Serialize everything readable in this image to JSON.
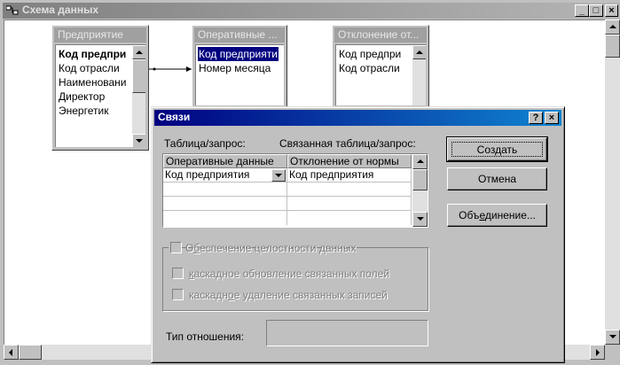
{
  "window": {
    "title": "Схема данных",
    "minimize": "_",
    "maximize": "□",
    "close": "×"
  },
  "tables": [
    {
      "title": "Предприятие",
      "fields": [
        "Код предпри",
        "Код отрасли",
        "Наименовани",
        "Директор",
        "Энергетик"
      ]
    },
    {
      "title": "Оперативные ...",
      "fields": [
        "Код предприяти",
        "Номер месяца"
      ]
    },
    {
      "title": "Отклонение от...",
      "fields": [
        "Код предпри",
        "Код отрасли"
      ]
    }
  ],
  "dialog": {
    "title": "Связи",
    "help": "?",
    "close": "×",
    "label_table": "Таблица/запрос:",
    "label_related": "Связанная таблица/запрос:",
    "grid": {
      "headers": [
        "Оперативные данные",
        "Отклонение от нормы"
      ],
      "rows": [
        [
          "Код предприятия",
          "Код предприятия"
        ]
      ]
    },
    "buttons": {
      "create": {
        "before": "Соз",
        "hot": "д",
        "after": "ать"
      },
      "cancel": "Отмена",
      "join": {
        "before": "Объ",
        "hot": "е",
        "after": "динение..."
      }
    },
    "integrity": {
      "before": "О",
      "hot": "б",
      "after": "еспечение целостности данных"
    },
    "cascade_update": {
      "before": "",
      "hot": "к",
      "after": "аскадное обновление связанных полей"
    },
    "cascade_delete": {
      "before": "каскадн",
      "hot": "о",
      "after": "е удаление связанных записей"
    },
    "relation_type_label": "Тип отношения:",
    "relation_type_value": ""
  },
  "colors": {
    "active_title": "#000080",
    "inactive_title": "#808080",
    "selection": "#000080"
  }
}
